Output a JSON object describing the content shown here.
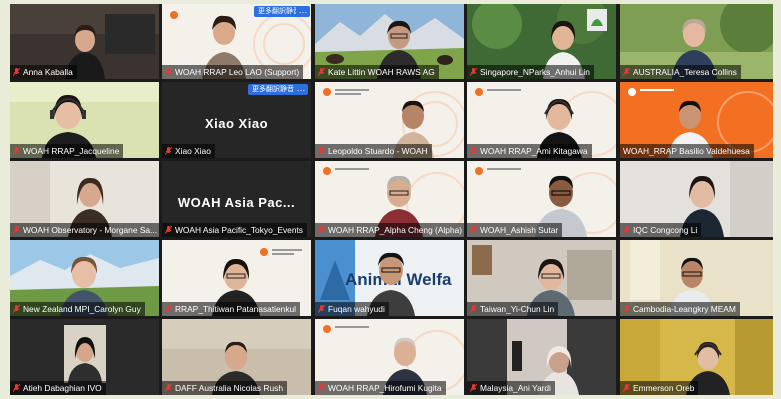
{
  "toolbar": {
    "rename_label": "更多翻訳静音",
    "more_label": "…"
  },
  "tiles": [
    {
      "name": "Anna Kaballa"
    },
    {
      "name": "WOAH RRAP Leo LAO (Support)"
    },
    {
      "name": "Kate Littin WOAH RAWS AG"
    },
    {
      "name": "Singapore_NParks_Anhui Lin"
    },
    {
      "name": "AUSTRALIA_Teresa Collins"
    },
    {
      "name": "WOAH RRAP_Jacqueline"
    },
    {
      "name": "Xiao Xiao",
      "display": "Xiao Xiao"
    },
    {
      "name": "Leopoldo Stuardo - WOAH"
    },
    {
      "name": "WOAH RRAP_Ami Kitagawa"
    },
    {
      "name": "WOAH_RRAP Basilio Valdehuesa"
    },
    {
      "name": "WOAH Observatory - Morgane Sa..."
    },
    {
      "name": "WOAH Asia Pacific_Tokyo_Events",
      "display": "WOAH  Asia  Pac..."
    },
    {
      "name": "WOAH RRAP_Alpha Cheng (Alpha)"
    },
    {
      "name": "WOAH_Ashish Sutar"
    },
    {
      "name": "IQC Congcong Li"
    },
    {
      "name": "New Zealand MPI_Carolyn Guy"
    },
    {
      "name": "RRAP_Thitiwan Patanasatienkul"
    },
    {
      "name": "Fuqan wahyudi"
    },
    {
      "name": "Taiwan_Yi-Chun Lin"
    },
    {
      "name": "Cambodia-Leangkry MEAM"
    },
    {
      "name": "Atieh Dabaghian IVO"
    },
    {
      "name": "DAFF Australia Nicolas Rush"
    },
    {
      "name": "WOAH RRAP_Hirofumi Kugita"
    },
    {
      "name": "Malaysia_Ani Yardi"
    },
    {
      "name": "Emmerson Oreb"
    }
  ],
  "banner_text": "Animal Welfa",
  "colors": {
    "woah_orange": "#f36f21",
    "active_border": "#d8e070",
    "button_blue": "#2d6fe0"
  }
}
